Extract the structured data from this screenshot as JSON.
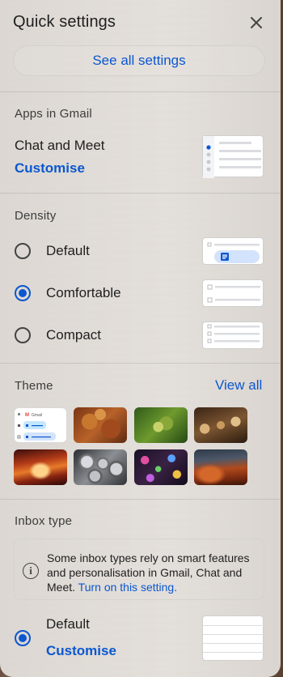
{
  "panel": {
    "title": "Quick settings",
    "close_icon": "close-icon",
    "see_all_label": "See all settings"
  },
  "apps": {
    "section_title": "Apps in Gmail",
    "name": "Chat and Meet",
    "customise_label": "Customise"
  },
  "density": {
    "section_title": "Density",
    "options": [
      {
        "label": "Default",
        "selected": false
      },
      {
        "label": "Comfortable",
        "selected": true
      },
      {
        "label": "Compact",
        "selected": false
      }
    ]
  },
  "theme": {
    "section_title": "Theme",
    "view_all_label": "View all",
    "default_tile_label": "Gmail",
    "tiles": [
      "default-theme",
      "autumn-leaves",
      "green-caterpillar",
      "chess-pieces",
      "canyon-glow",
      "metal-pipes",
      "bokeh-lights",
      "desert-canyon"
    ]
  },
  "inbox": {
    "section_title": "Inbox type",
    "info_text": "Some inbox types rely on smart features and personalisation in Gmail, Chat and Meet. ",
    "info_link": "Turn on this setting.",
    "option_label": "Default",
    "option_selected": true,
    "customise_label": "Customise"
  },
  "colors": {
    "accent": "#0b57d0",
    "text": "#1f1f1f"
  }
}
